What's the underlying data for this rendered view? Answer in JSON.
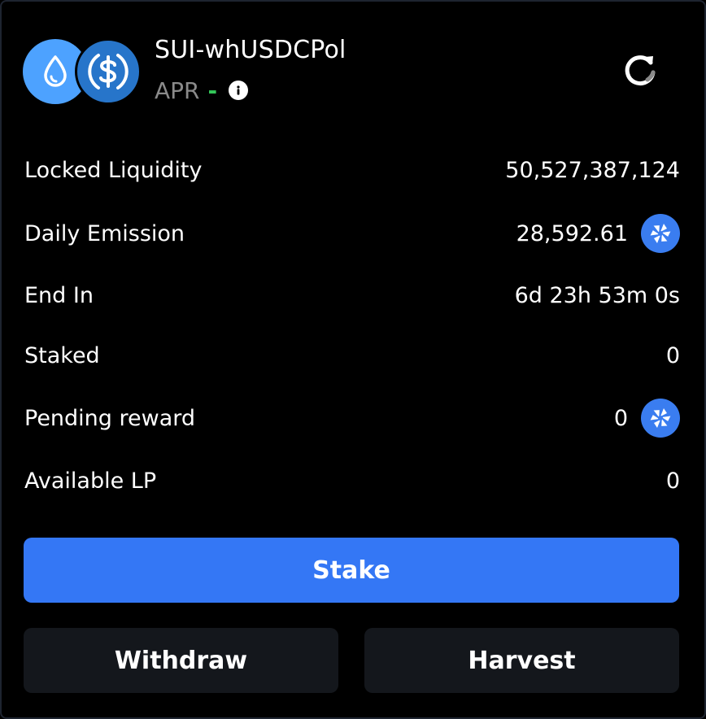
{
  "pool": {
    "pair_name": "SUI-whUSDCPol",
    "apr_label": "APR",
    "apr_value": "-",
    "tokens": [
      {
        "name": "SUI",
        "icon": "water-drop-icon",
        "color": "#4da2ff"
      },
      {
        "name": "USDC",
        "icon": "dollar-circle-icon",
        "color": "#2775ca"
      }
    ]
  },
  "stats": [
    {
      "label": "Locked Liquidity",
      "value": "50,527,387,124",
      "has_token_icon": false
    },
    {
      "label": "Daily Emission",
      "value": "28,592.61",
      "has_token_icon": true
    },
    {
      "label": "End In",
      "value": "6d 23h 53m 0s",
      "has_token_icon": false
    },
    {
      "label": "Staked",
      "value": "0",
      "has_token_icon": false
    },
    {
      "label": "Pending reward",
      "value": "0",
      "has_token_icon": true
    },
    {
      "label": "Available LP",
      "value": "0",
      "has_token_icon": false
    }
  ],
  "actions": {
    "stake_label": "Stake",
    "withdraw_label": "Withdraw",
    "harvest_label": "Harvest"
  },
  "colors": {
    "background": "#000000",
    "primary": "#3477f5",
    "secondary_button": "#14171c",
    "apr_accent": "#34c759",
    "muted_text": "#8a8a8a",
    "reward_token": "#3a7df0"
  },
  "icons": {
    "refresh": "refresh-icon",
    "info": "info-icon",
    "reward_token": "pinwheel-token-icon"
  }
}
